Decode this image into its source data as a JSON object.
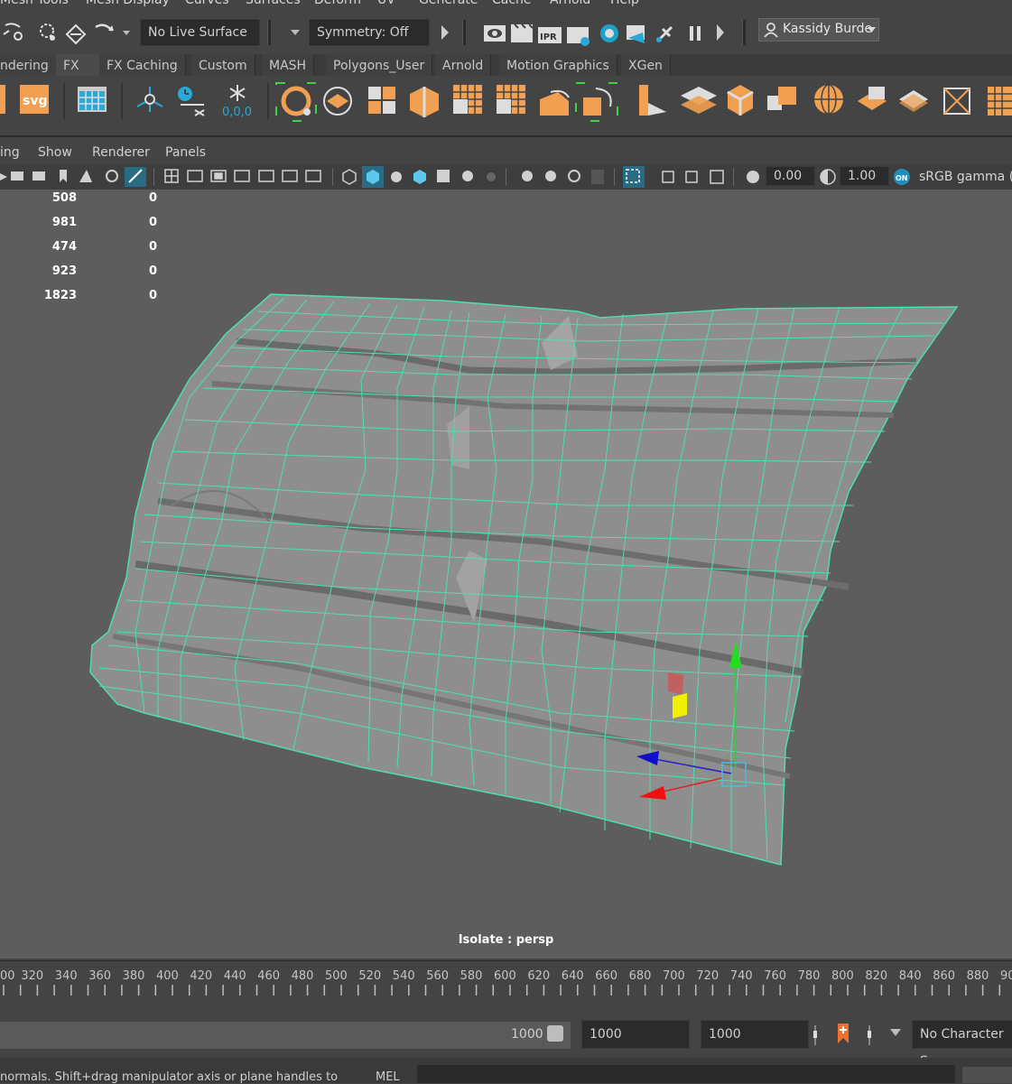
{
  "menubar": [
    "Mesh Tools",
    "Mesh Display",
    "Curves",
    "Surfaces",
    "Deform",
    "UV",
    "Generate",
    "Cache",
    "Arnold",
    "Help"
  ],
  "statusline": {
    "live_surface": "No Live Surface",
    "symmetry": "Symmetry: Off",
    "user": "Kassidy Burde"
  },
  "shelf_tabs": [
    "ndering",
    "FX",
    "FX Caching",
    "Custom",
    "MASH",
    "Polygons_User",
    "Arnold",
    "Motion Graphics",
    "XGen"
  ],
  "shelf_icons": [
    "svg-icon",
    "uv-editor-icon",
    "locator-icon",
    "timer-icon",
    "freeze-icon",
    "sphere-select-icon",
    "plane-icon",
    "cube-grid-icon",
    "split-cube-icon",
    "grid-icon",
    "grid-icon",
    "wedge-icon",
    "bevel-icon",
    "extrude-icon",
    "stack-icon",
    "cube-icon",
    "combine-icon",
    "sphere-icon",
    "fold-icon",
    "slice-icon",
    "bridge-icon",
    "grid-icon"
  ],
  "panel_menu": [
    "ing",
    "Show",
    "Renderer",
    "Panels"
  ],
  "panel_toolbar": {
    "exposure": "0.00",
    "gamma": "1.00",
    "color_space": "sRGB gamma (le"
  },
  "hud_rows": [
    {
      "a": "508",
      "b": "0"
    },
    {
      "a": "981",
      "b": "0"
    },
    {
      "a": "474",
      "b": "0"
    },
    {
      "a": "923",
      "b": "0"
    },
    {
      "a": "1823",
      "b": "0"
    }
  ],
  "camera_label": "Isolate : persp",
  "time_ticks": [
    "00",
    "320",
    "340",
    "360",
    "380",
    "400",
    "420",
    "440",
    "460",
    "480",
    "500",
    "520",
    "540",
    "560",
    "580",
    "600",
    "620",
    "640",
    "660",
    "680",
    "700",
    "720",
    "740",
    "760",
    "780",
    "800",
    "820",
    "840",
    "860",
    "880",
    "90"
  ],
  "range": {
    "current_end": "1000",
    "start": "1000",
    "end": "1000",
    "character_set": "No Character Se"
  },
  "command_line": {
    "help_text": "normals. Shift+drag manipulator axis or plane handles to extr",
    "language": "MEL"
  },
  "colors": {
    "wire": "#4de0a6",
    "mesh": "#8d8d8d",
    "orange": "#f0a050",
    "accent_blue": "#2aa8d6"
  }
}
